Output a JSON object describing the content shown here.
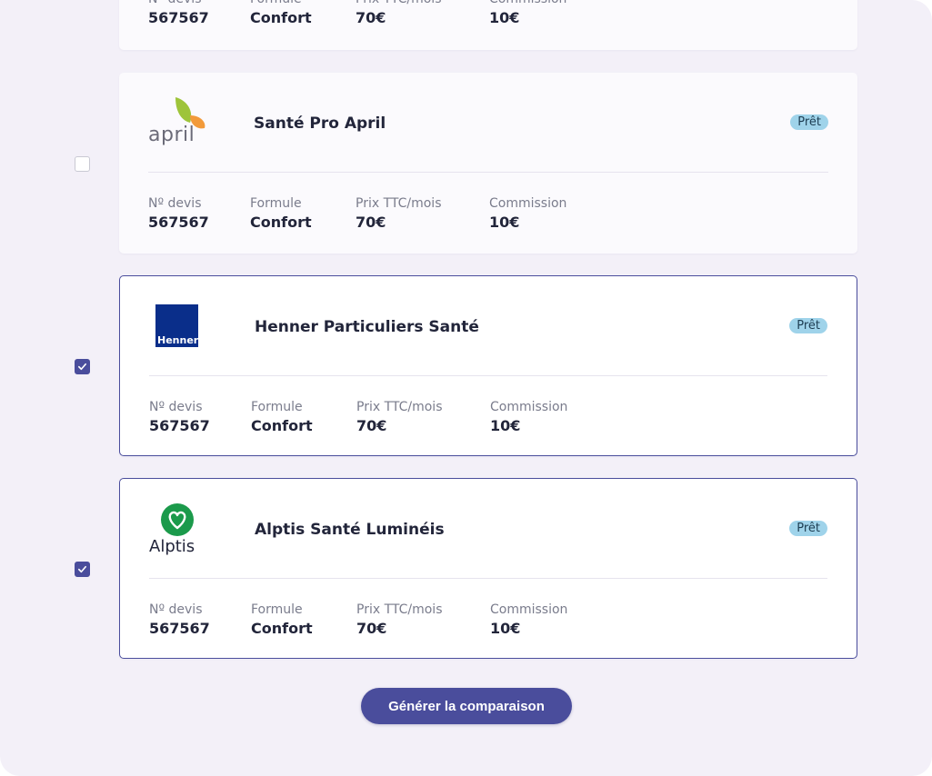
{
  "labels": {
    "devis": "Nº devis",
    "formule": "Formule",
    "prix": "Prix TTC/mois",
    "commission": "Commission"
  },
  "cards": [
    {
      "title": "",
      "status": "",
      "devis": "567567",
      "formule": "Confort",
      "prix": "70€",
      "commission": "10€",
      "selected": false
    },
    {
      "title": "Santé Pro April",
      "logo_text": "april",
      "status": "Prêt",
      "devis": "567567",
      "formule": "Confort",
      "prix": "70€",
      "commission": "10€",
      "selected": false
    },
    {
      "title": "Henner Particuliers Santé",
      "logo_text": "Henner",
      "status": "Prêt",
      "devis": "567567",
      "formule": "Confort",
      "prix": "70€",
      "commission": "10€",
      "selected": true
    },
    {
      "title": "Alptis Santé Luminéis",
      "logo_text": "Alptis",
      "status": "Prêt",
      "devis": "567567",
      "formule": "Confort",
      "prix": "70€",
      "commission": "10€",
      "selected": true
    }
  ],
  "colors": {
    "accent": "#4a4d9c",
    "badge": "#9fd3ea",
    "background": "#f3f0f8",
    "april_green": "#9ec43a",
    "april_orange": "#f29a3a",
    "henner_blue": "#0a2e8a",
    "alptis_green": "#1b9a4b"
  },
  "icons": [
    "check-icon",
    "april-logo",
    "henner-logo",
    "alptis-logo"
  ],
  "actions": {
    "generate_label": "Générer la comparaison"
  }
}
